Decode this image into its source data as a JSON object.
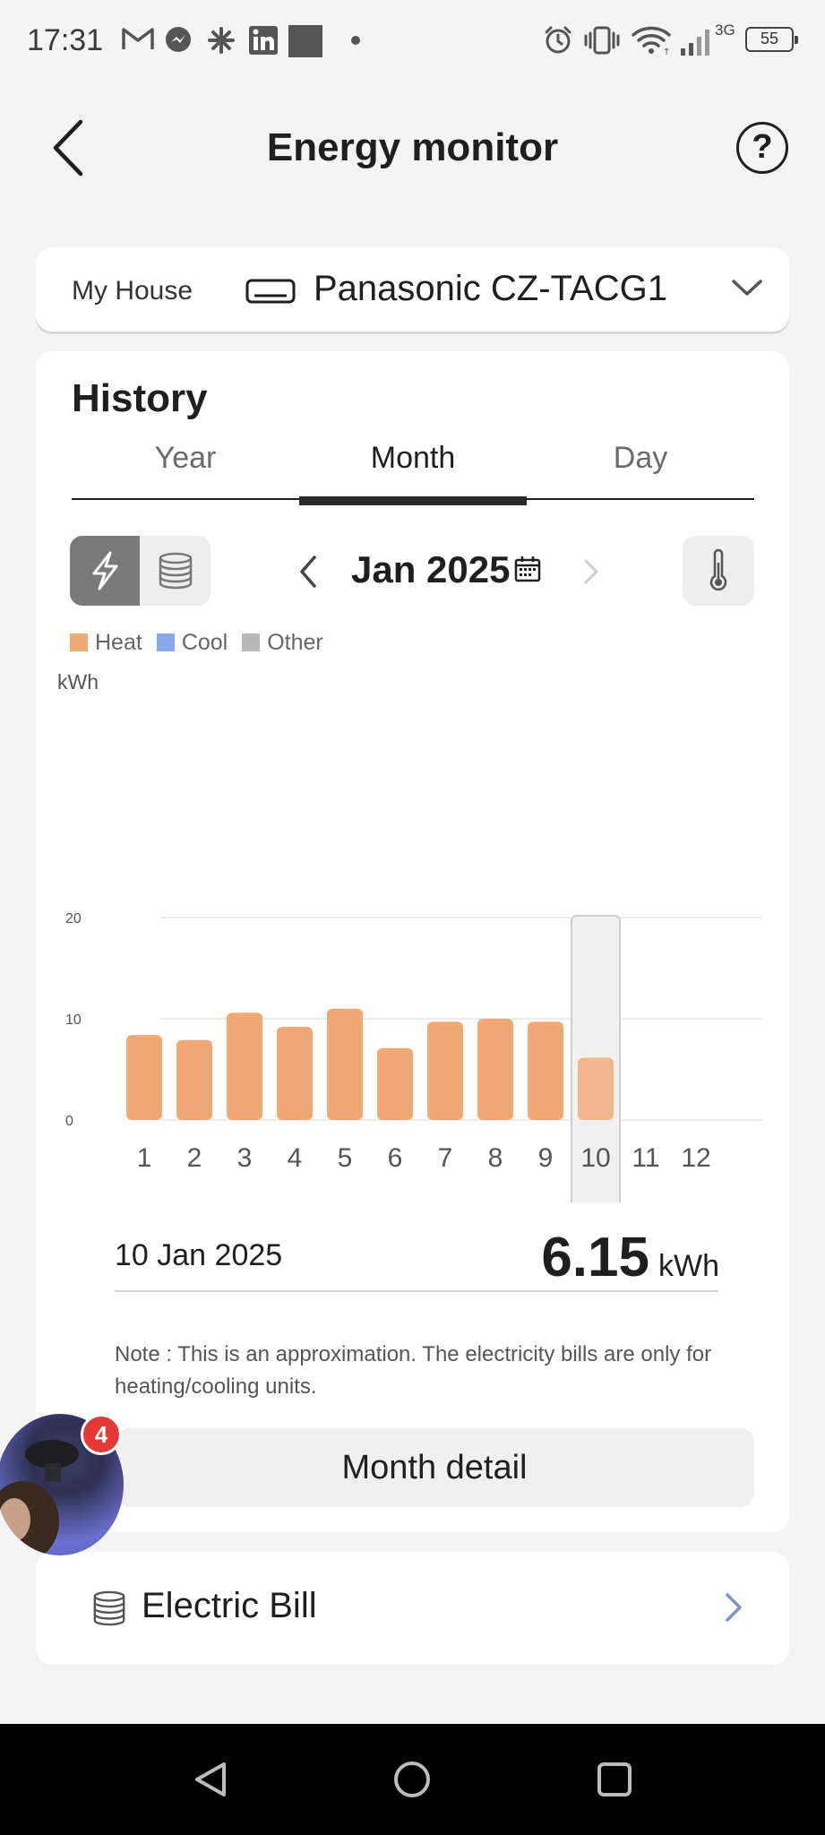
{
  "status_bar": {
    "time": "17:31",
    "icons": [
      "gmail-icon",
      "messenger-icon",
      "pinwheel-icon",
      "linkedin-icon",
      "app-square-icon",
      "notification-dot-icon",
      "alarm-icon",
      "vibrate-icon",
      "wifi-icon",
      "signal-icon"
    ],
    "network": "3G",
    "battery": "55"
  },
  "header": {
    "title": "Energy monitor",
    "help": "?"
  },
  "selector": {
    "home": "My House",
    "device": "Panasonic CZ-TACG1"
  },
  "history": {
    "title": "History",
    "tabs": [
      {
        "label": "Year"
      },
      {
        "label": "Month",
        "active": true
      },
      {
        "label": "Day"
      }
    ],
    "period_label": "Jan 2025",
    "legend": [
      {
        "name": "Heat",
        "color": "#f0a875"
      },
      {
        "name": "Cool",
        "color": "#89a8ee"
      },
      {
        "name": "Other",
        "color": "#b8b8b8"
      }
    ],
    "readout": {
      "date": "10 Jan 2025",
      "value": "6.15",
      "unit": "kWh"
    },
    "note": "Note : This is an approximation. The electricity bills are only for heating/cooling units.",
    "detail_button": "Month detail"
  },
  "chart_data": {
    "type": "bar",
    "ylabel": "kWh",
    "ylim": [
      0,
      20
    ],
    "yticks": [
      "20",
      "10",
      "0"
    ],
    "categories": [
      "1",
      "2",
      "3",
      "4",
      "5",
      "6",
      "7",
      "8",
      "9",
      "10",
      "11",
      "12"
    ],
    "series": [
      {
        "name": "Heat",
        "color": "#f0a875",
        "values": [
          8.4,
          7.9,
          10.6,
          9.2,
          11.0,
          7.1,
          9.7,
          10.0,
          9.7,
          6.15,
          null,
          null
        ]
      }
    ],
    "highlight_index": 9,
    "grid": true
  },
  "bill": {
    "label": "Electric Bill"
  },
  "chathead": {
    "badge": "4"
  }
}
